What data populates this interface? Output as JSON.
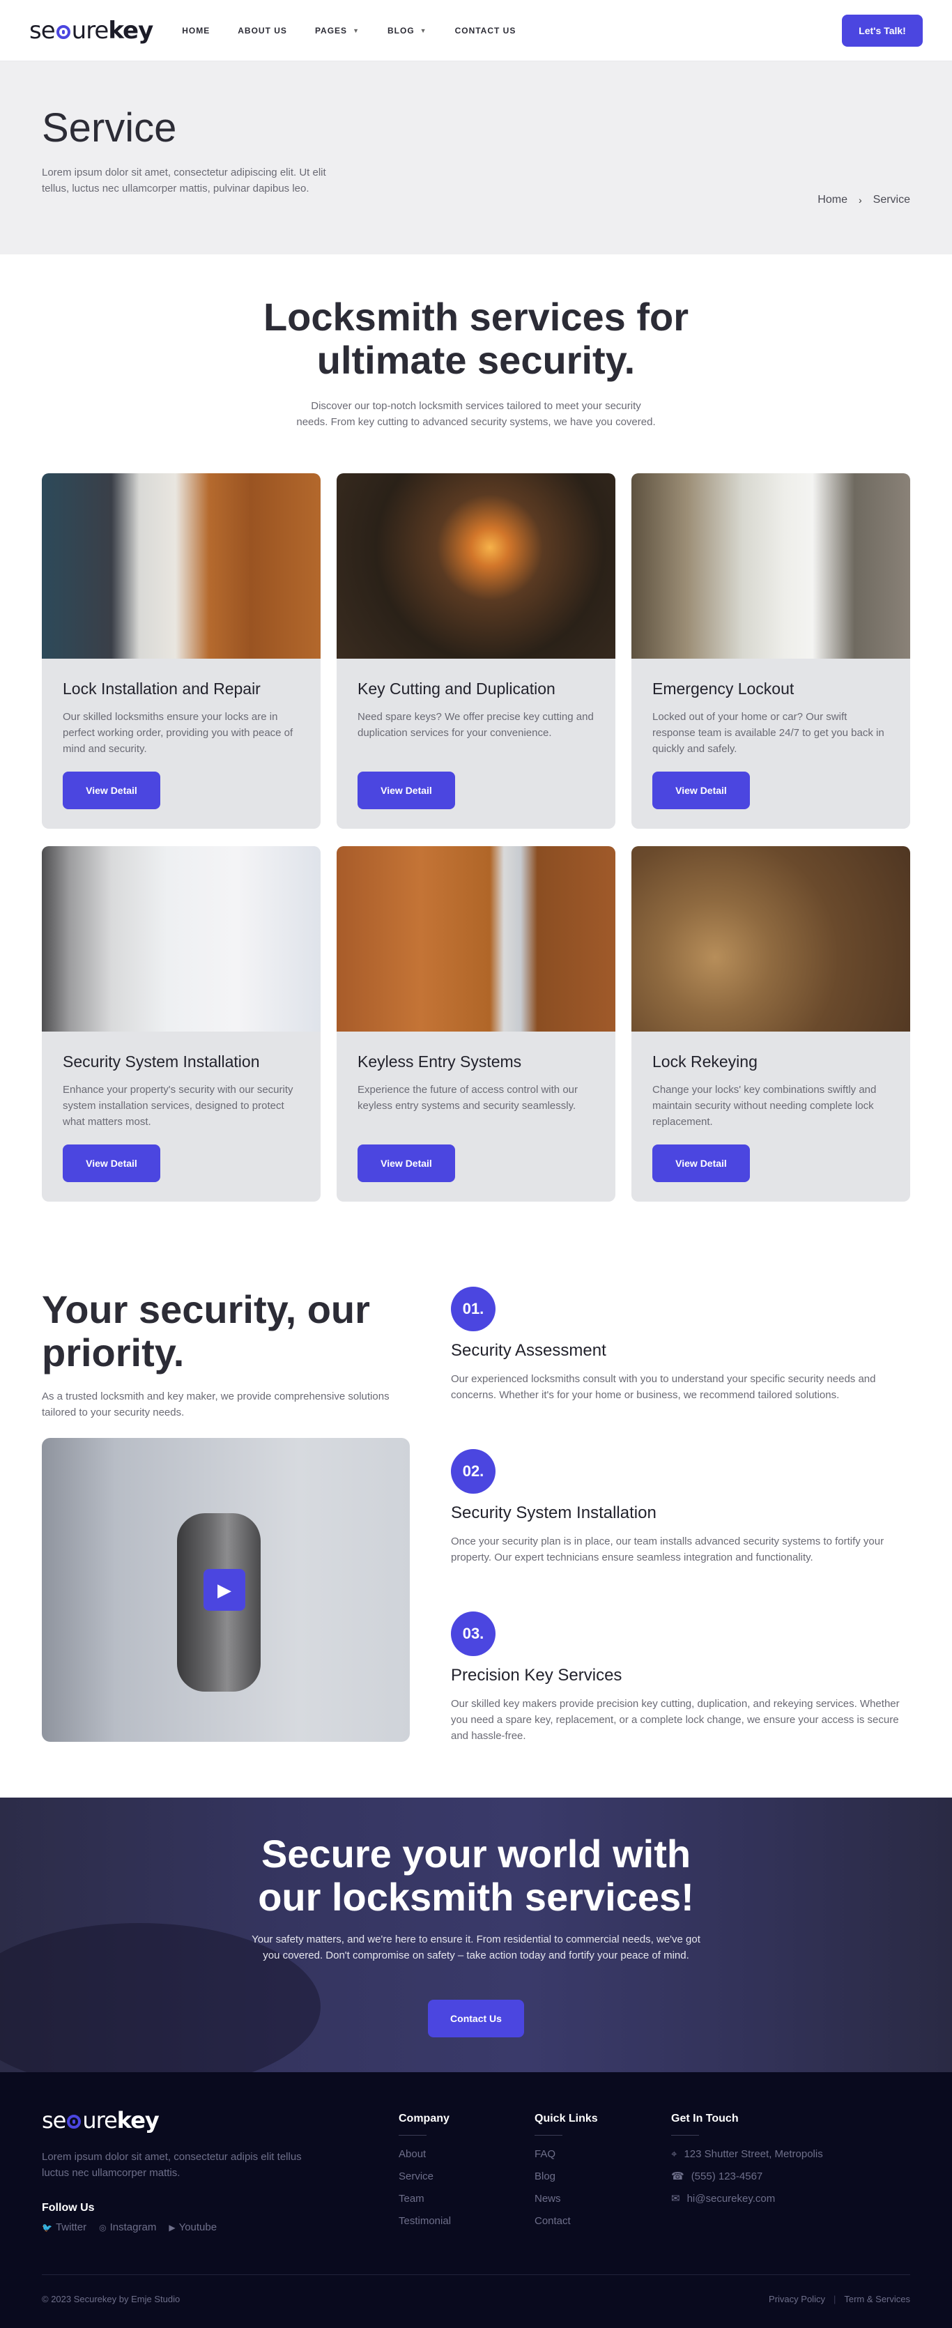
{
  "header": {
    "logo": {
      "part1": "se",
      "part2": "ure",
      "part3": "key"
    },
    "nav": [
      {
        "label": "HOME",
        "dropdown": false
      },
      {
        "label": "ABOUT US",
        "dropdown": false
      },
      {
        "label": "PAGES",
        "dropdown": true
      },
      {
        "label": "BLOG",
        "dropdown": true
      },
      {
        "label": "CONTACT US",
        "dropdown": false
      }
    ],
    "cta_label": "Let's Talk!"
  },
  "hero": {
    "title": "Service",
    "description": "Lorem ipsum dolor sit amet, consectetur adipiscing elit. Ut elit tellus, luctus nec ullamcorper mattis, pulvinar dapibus leo.",
    "breadcrumb": [
      "Home",
      "Service"
    ]
  },
  "services": {
    "title_line1": "Locksmith services for",
    "title_line2": "ultimate security.",
    "subtitle_line1": "Discover our top-notch locksmith services tailored to meet your security",
    "subtitle_line2": "needs. From key cutting to advanced security systems, we have you covered.",
    "button_label": "View Detail",
    "cards": [
      {
        "title": "Lock Installation and Repair",
        "desc": "Our skilled locksmiths ensure your locks are in perfect working order, providing you with peace of mind and security."
      },
      {
        "title": "Key Cutting and Duplication",
        "desc": "Need spare keys? We offer precise key cutting and duplication services for your convenience."
      },
      {
        "title": "Emergency Lockout",
        "desc": "Locked out of your home or car? Our swift response team is available 24/7 to get you back in quickly and safely."
      },
      {
        "title": "Security System Installation",
        "desc": "Enhance your property's security with our security system installation services, designed to protect what matters most."
      },
      {
        "title": "Keyless Entry Systems",
        "desc": "Experience the future of access control with our keyless entry systems and security seamlessly."
      },
      {
        "title": "Lock Rekeying",
        "desc": "Change your locks' key combinations swiftly and maintain security without needing complete lock replacement."
      }
    ]
  },
  "priority": {
    "title": "Your security, our priority.",
    "description": "As a trusted locksmith and key maker, we provide comprehensive solutions tailored to your security needs.",
    "steps": [
      {
        "num": "01.",
        "title": "Security Assessment",
        "desc": "Our experienced locksmiths consult with you to understand your specific security needs and concerns. Whether it's for your home or business, we recommend tailored solutions."
      },
      {
        "num": "02.",
        "title": "Security System Installation",
        "desc": "Once your security plan is in place, our team installs advanced security systems to fortify your property. Our expert technicians ensure seamless integration and functionality."
      },
      {
        "num": "03.",
        "title": "Precision Key Services",
        "desc": "Our skilled key makers provide precision key cutting, duplication, and rekeying services. Whether you need a spare key, replacement, or a complete lock change, we ensure your access is secure and hassle-free."
      }
    ]
  },
  "cta": {
    "title_line1": "Secure your world with",
    "title_line2": "our locksmith services!",
    "description": "Your safety matters, and we're here to ensure it. From residential to commercial needs, we've got you covered. Don't compromise on safety – take action today and fortify your peace of mind.",
    "button_label": "Contact Us"
  },
  "footer": {
    "description": "Lorem ipsum dolor sit amet, consectetur adipis elit tellus luctus nec ullamcorper mattis.",
    "follow_label": "Follow Us",
    "socials": [
      "Twitter",
      "Instagram",
      "Youtube"
    ],
    "company": {
      "heading": "Company",
      "links": [
        "About",
        "Service",
        "Team",
        "Testimonial"
      ]
    },
    "quick": {
      "heading": "Quick Links",
      "links": [
        "FAQ",
        "Blog",
        "News",
        "Contact"
      ]
    },
    "touch": {
      "heading": "Get In Touch",
      "address": "123 Shutter Street, Metropolis",
      "phone": "(555) 123-4567",
      "email": "hi@securekey.com"
    },
    "copyright": "© 2023 Securekey by Emje Studio",
    "legal": [
      "Privacy Policy",
      "Term & Services"
    ]
  },
  "colors": {
    "accent": "#4b46e0",
    "footer_bg": "#090a1e",
    "hero_bg": "#efeff1",
    "card_bg": "#e3e4e7"
  }
}
